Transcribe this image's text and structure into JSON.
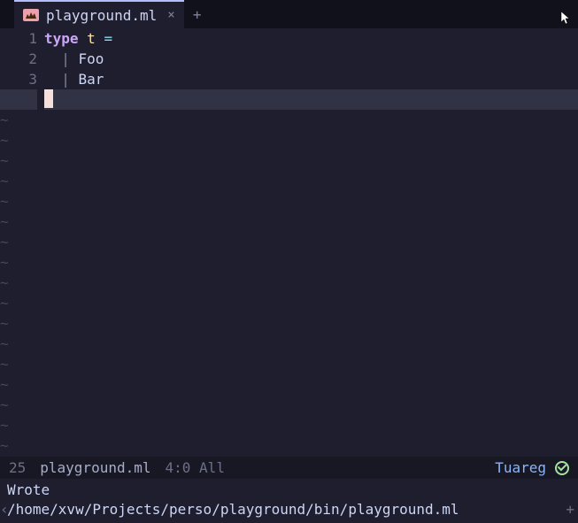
{
  "tabbar": {
    "active_tab": {
      "label": "playground.ml",
      "close_glyph": "×"
    },
    "new_tab_glyph": "+"
  },
  "editor": {
    "lines": [
      {
        "num": "1",
        "tokens": [
          {
            "t": "type",
            "c": "kw"
          },
          {
            "t": " ",
            "c": ""
          },
          {
            "t": "t",
            "c": "ty"
          },
          {
            "t": " ",
            "c": ""
          },
          {
            "t": "=",
            "c": "op"
          }
        ]
      },
      {
        "num": "2",
        "tokens": [
          {
            "t": "  ",
            "c": ""
          },
          {
            "t": "|",
            "c": "pipe"
          },
          {
            "t": " Foo",
            "c": ""
          }
        ]
      },
      {
        "num": "3",
        "tokens": [
          {
            "t": "  ",
            "c": ""
          },
          {
            "t": "|",
            "c": "pipe"
          },
          {
            "t": " Bar",
            "c": ""
          }
        ]
      }
    ],
    "tilde": "~"
  },
  "modeline": {
    "line_count": "25",
    "buffer_name": "playground.ml",
    "position": "4:0",
    "scroll": "All",
    "major_mode": "Tuareg"
  },
  "minibuffer": {
    "line1": "Wrote",
    "line2": "/home/xvw/Projects/perso/playground/bin/playground.ml",
    "trunc_glyph": "‹",
    "plus_glyph": "+"
  }
}
